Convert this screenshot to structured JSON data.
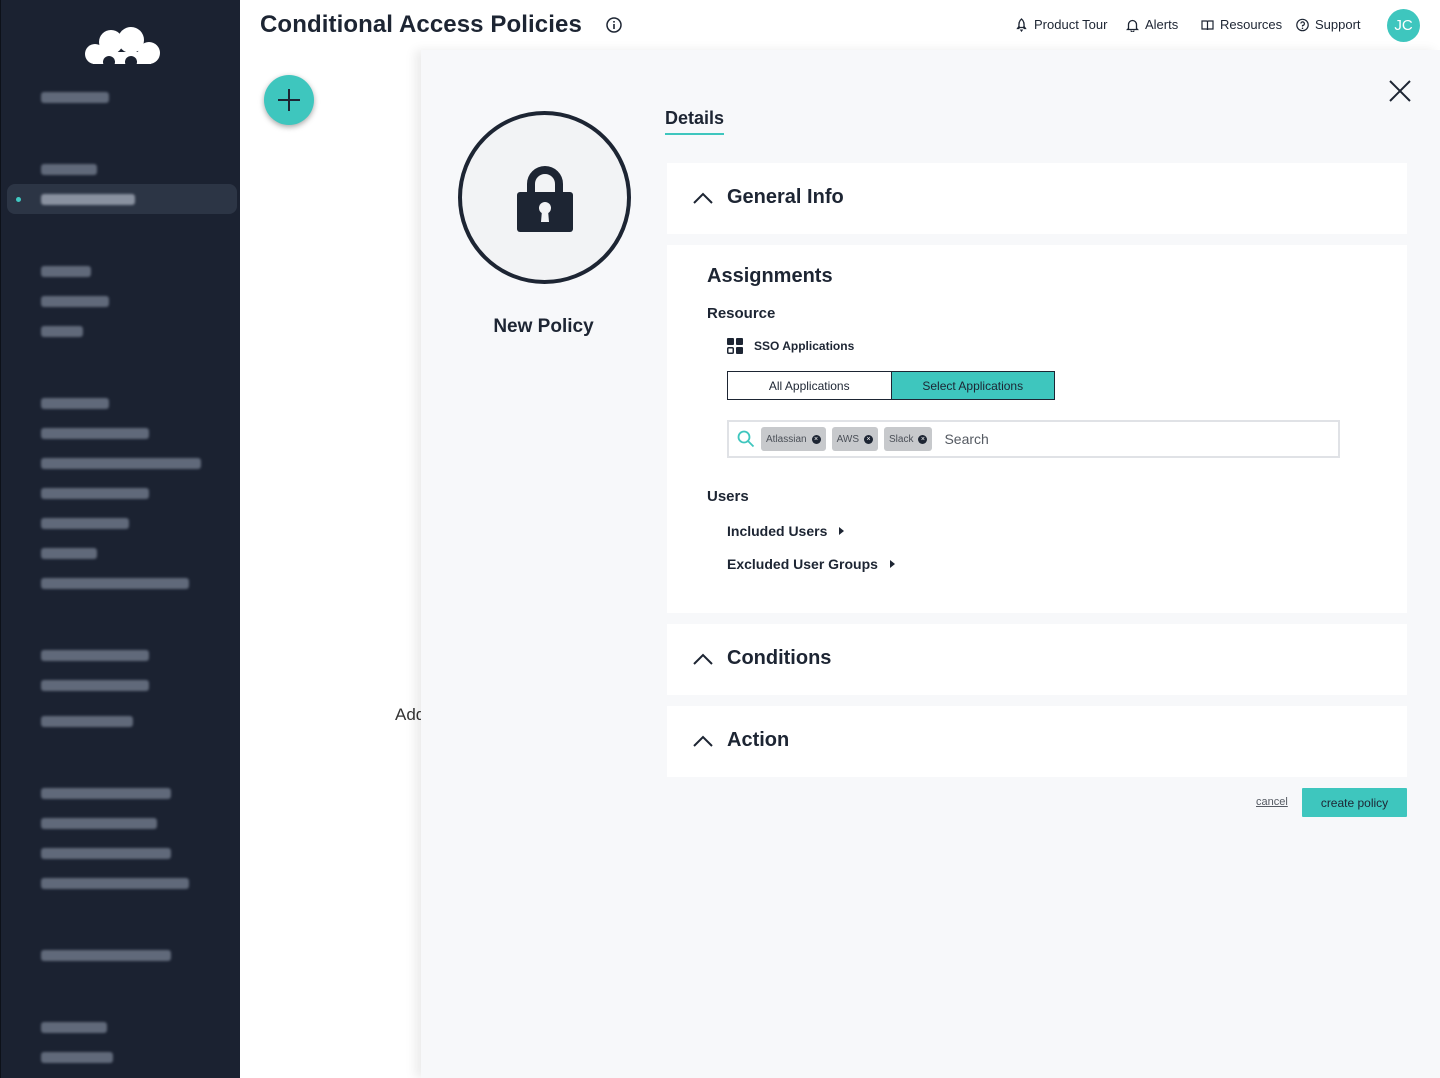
{
  "header": {
    "title": "Conditional Access Policies",
    "nav": [
      {
        "label": "Product Tour",
        "icon": "rocket-icon"
      },
      {
        "label": "Alerts",
        "icon": "bell-icon"
      },
      {
        "label": "Resources",
        "icon": "book-icon"
      },
      {
        "label": "Support",
        "icon": "help-circle-icon"
      }
    ],
    "avatar_initials": "JC"
  },
  "background": {
    "add_text": "Add"
  },
  "drawer": {
    "policy_name": "New Policy",
    "tab": "Details",
    "sections": {
      "general_info": "General Info",
      "conditions": "Conditions",
      "action": "Action"
    },
    "assignments": {
      "title": "Assignments",
      "resource_label": "Resource",
      "sso_label": "SSO Applications",
      "segment": {
        "all": "All Applications",
        "select": "Select Applications",
        "selected": "Select Applications"
      },
      "chips": [
        "Atlassian",
        "AWS",
        "Slack"
      ],
      "search_placeholder": "Search",
      "users_label": "Users",
      "included_users": "Included Users",
      "excluded_groups": "Excluded User Groups"
    },
    "footer": {
      "cancel": "cancel",
      "create": "create policy"
    }
  },
  "colors": {
    "sidebar": "#1b2231",
    "accent": "#3ec6be",
    "text": "#1d2533",
    "drawer_bg": "#f7f8fa"
  }
}
